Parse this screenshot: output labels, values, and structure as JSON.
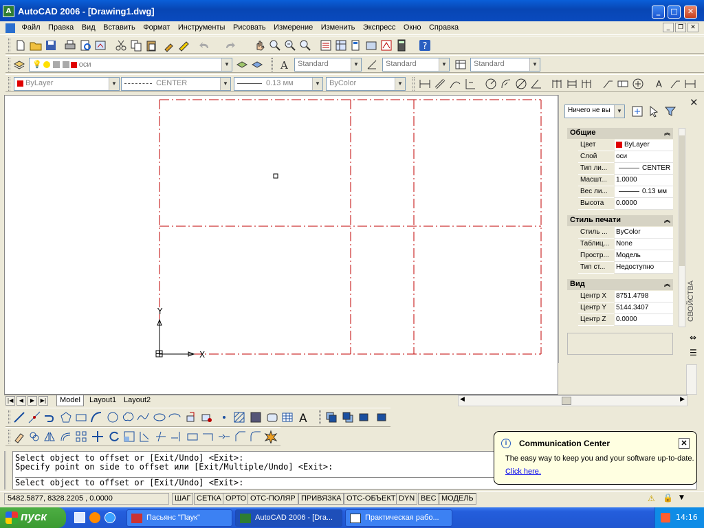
{
  "window": {
    "title": "AutoCAD 2006 - [Drawing1.dwg]",
    "app_icon_text": "A"
  },
  "menu": [
    "Файл",
    "Правка",
    "Вид",
    "Вставить",
    "Формат",
    "Инструменты",
    "Рисовать",
    "Измерение",
    "Изменить",
    "Экспресс",
    "Окно",
    "Справка"
  ],
  "layers_toolbar": {
    "layer": "оси",
    "text_style": "Standard",
    "dim_style": "Standard",
    "table_style": "Standard"
  },
  "properties_toolbar": {
    "color": "ByLayer",
    "linetype": "CENTER",
    "lineweight": "0.13 мм",
    "plotstyle": "ByColor"
  },
  "drawing": {
    "axis_y": "Y",
    "axis_x": "X"
  },
  "palette": {
    "selector": "Ничего не вы",
    "side_label": "СВОЙСТВА",
    "sections": [
      {
        "title": "Общие",
        "rows": [
          {
            "k": "Цвет",
            "v": "ByLayer"
          },
          {
            "k": "Слой",
            "v": "оси"
          },
          {
            "k": "Тип ли...",
            "v": "CENTER"
          },
          {
            "k": "Масшт...",
            "v": "1.0000"
          },
          {
            "k": "Вес ли...",
            "v": "0.13 мм"
          },
          {
            "k": "Высота",
            "v": "0.0000"
          }
        ]
      },
      {
        "title": "Стиль печати",
        "rows": [
          {
            "k": "Стиль ...",
            "v": "ByColor"
          },
          {
            "k": "Таблиц...",
            "v": "None"
          },
          {
            "k": "Простр...",
            "v": "Модель"
          },
          {
            "k": "Тип ст...",
            "v": "Недоступно"
          }
        ]
      },
      {
        "title": "Вид",
        "rows": [
          {
            "k": "Центр X",
            "v": "8751.4798"
          },
          {
            "k": "Центр Y",
            "v": "5144.3407"
          },
          {
            "k": "Центр Z",
            "v": "0.0000"
          }
        ]
      }
    ]
  },
  "tabs": [
    "Model",
    "Layout1",
    "Layout2"
  ],
  "command": {
    "line1": "Select object to offset or [Exit/Undo] <Exit>:",
    "line2": "Specify point on side to offset или [Exit/Multiple/Undo] <Exit>:",
    "prompt": "Select object to offset or [Exit/Undo] <Exit>:"
  },
  "balloon": {
    "title": "Communication Center",
    "text": "The easy way to keep you and your software up-to-date.",
    "link": "Click here."
  },
  "status": {
    "coords": "5482.5877, 8328.2205 , 0.0000",
    "buttons": [
      "ШАГ",
      "СЕТКА",
      "ОРТО",
      "ОТС-ПОЛЯР",
      "ПРИВЯЗКА",
      "ОТС-ОБЪЕКТ",
      "DYN",
      "ВЕС",
      "МОДЕЛЬ"
    ]
  },
  "taskbar": {
    "start": "пуск",
    "tasks": [
      "Пасьянс \"Паук\"",
      "AutoCAD 2006 - [Dra...",
      "Практическая рабо..."
    ],
    "clock": "14:16"
  }
}
